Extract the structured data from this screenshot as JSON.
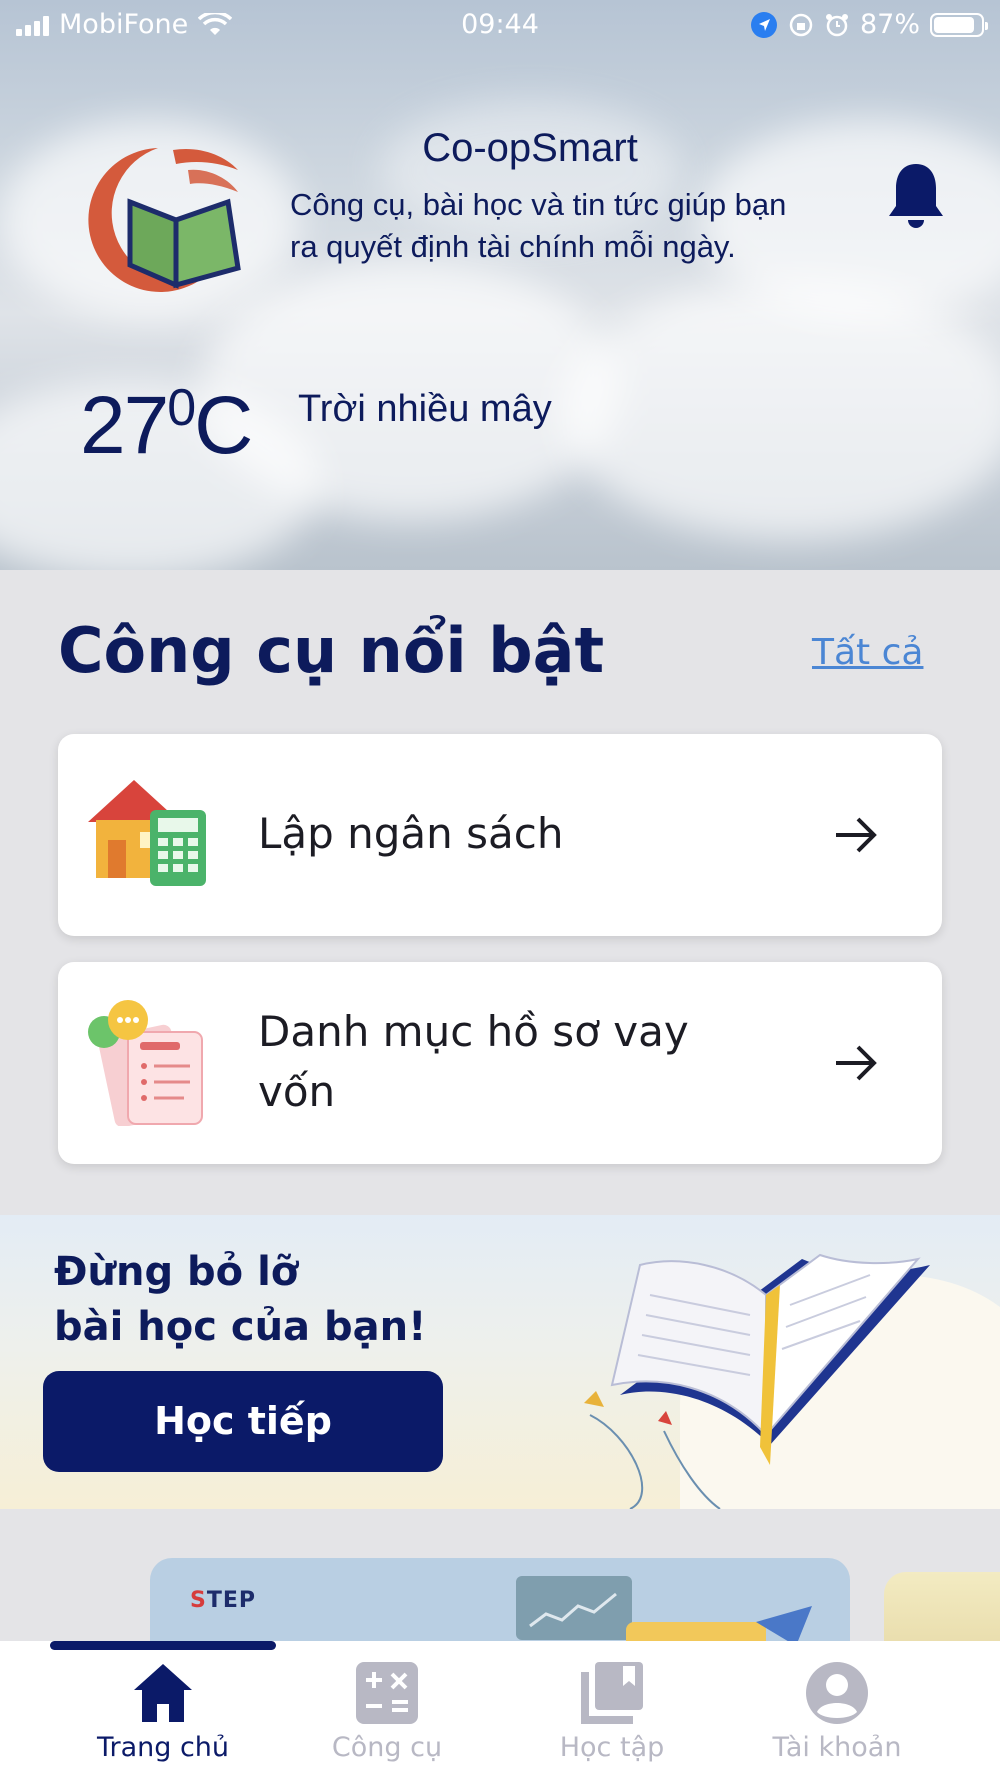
{
  "status_bar": {
    "carrier": "MobiFone",
    "time": "09:44",
    "battery": "87%",
    "battery_level": 0.87
  },
  "header": {
    "app_name": "Co-opSmart",
    "tagline_line1": "Công cụ, bài học và tin tức giúp bạn",
    "tagline_line2": "ra quyết định tài chính mỗi ngày."
  },
  "weather": {
    "temperature": "27",
    "unit": "C",
    "description": "Trời nhiều mây"
  },
  "featured": {
    "title": "Công cụ nổi bật",
    "see_all": "Tất cả",
    "cards": [
      {
        "label": "Lập ngân sách",
        "icon": "house-calculator-icon"
      },
      {
        "label_line1": "Danh mục hồ sơ vay",
        "label_line2": "vốn",
        "icon": "loan-documents-icon"
      }
    ]
  },
  "banner": {
    "line1": "Đừng bỏ lỡ",
    "line2": "bài học của bạn!",
    "button": "Học tiếp"
  },
  "carousel": {
    "logo_prefix": "S",
    "logo_rest": "TEP"
  },
  "tabs": [
    {
      "label": "Trang chủ",
      "icon": "home-icon",
      "active": true
    },
    {
      "label": "Công cụ",
      "icon": "calculator-icon",
      "active": false
    },
    {
      "label": "Học tập",
      "icon": "library-icon",
      "active": false
    },
    {
      "label": "Tài khoản",
      "icon": "account-icon",
      "active": false
    }
  ],
  "colors": {
    "primary": "#0b1a68",
    "link": "#4b86d4",
    "background": "#e4e4e7"
  }
}
